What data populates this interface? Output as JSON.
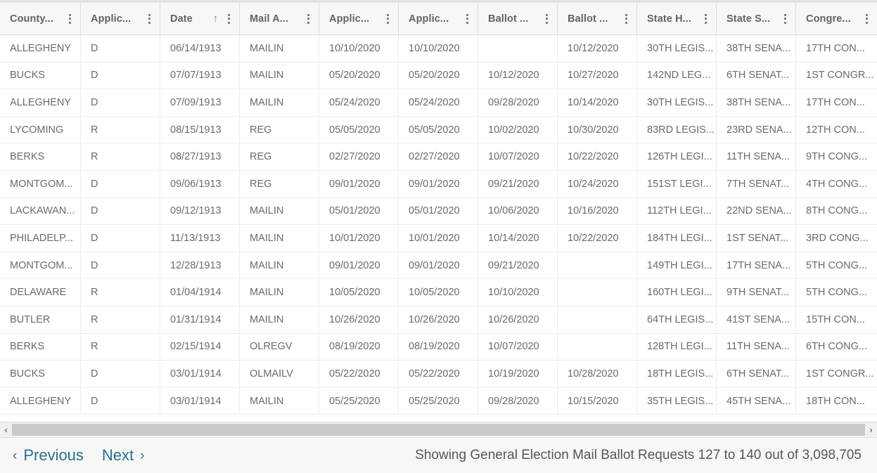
{
  "table": {
    "columns": [
      {
        "label": "County...",
        "sorted": false,
        "sort_icon": "",
        "menu_icon": "kebab-menu-icon"
      },
      {
        "label": "Applic...",
        "sorted": false,
        "sort_icon": "",
        "menu_icon": "kebab-menu-icon"
      },
      {
        "label": "Date",
        "sorted": true,
        "sort_icon": "↑",
        "menu_icon": "kebab-menu-icon"
      },
      {
        "label": "Mail A...",
        "sorted": false,
        "sort_icon": "",
        "menu_icon": "kebab-menu-icon"
      },
      {
        "label": "Applic...",
        "sorted": false,
        "sort_icon": "",
        "menu_icon": "kebab-menu-icon"
      },
      {
        "label": "Applic...",
        "sorted": false,
        "sort_icon": "",
        "menu_icon": "kebab-menu-icon"
      },
      {
        "label": "Ballot ...",
        "sorted": false,
        "sort_icon": "",
        "menu_icon": "kebab-menu-icon"
      },
      {
        "label": "Ballot ...",
        "sorted": false,
        "sort_icon": "",
        "menu_icon": "kebab-menu-icon"
      },
      {
        "label": "State H...",
        "sorted": false,
        "sort_icon": "",
        "menu_icon": "kebab-menu-icon"
      },
      {
        "label": "State S...",
        "sorted": false,
        "sort_icon": "",
        "menu_icon": "kebab-menu-icon"
      },
      {
        "label": "Congre...",
        "sorted": false,
        "sort_icon": "",
        "menu_icon": "kebab-menu-icon"
      }
    ],
    "rows": [
      [
        "ALLEGHENY",
        "D",
        "06/14/1913",
        "MAILIN",
        "10/10/2020",
        "10/10/2020",
        "",
        "10/12/2020",
        "30TH LEGIS...",
        "38TH SENA...",
        "17TH CON..."
      ],
      [
        "BUCKS",
        "D",
        "07/07/1913",
        "MAILIN",
        "05/20/2020",
        "05/20/2020",
        "10/12/2020",
        "10/27/2020",
        "142ND LEG...",
        "6TH SENAT...",
        "1ST CONGR..."
      ],
      [
        "ALLEGHENY",
        "D",
        "07/09/1913",
        "MAILIN",
        "05/24/2020",
        "05/24/2020",
        "09/28/2020",
        "10/14/2020",
        "30TH LEGIS...",
        "38TH SENA...",
        "17TH CON..."
      ],
      [
        "LYCOMING",
        "R",
        "08/15/1913",
        "REG",
        "05/05/2020",
        "05/05/2020",
        "10/02/2020",
        "10/30/2020",
        "83RD LEGIS...",
        "23RD SENA...",
        "12TH CON..."
      ],
      [
        "BERKS",
        "R",
        "08/27/1913",
        "REG",
        "02/27/2020",
        "02/27/2020",
        "10/07/2020",
        "10/22/2020",
        "126TH LEGI...",
        "11TH SENA...",
        "9TH CONG..."
      ],
      [
        "MONTGOM...",
        "D",
        "09/06/1913",
        "REG",
        "09/01/2020",
        "09/01/2020",
        "09/21/2020",
        "10/24/2020",
        "151ST LEGI...",
        "7TH SENAT...",
        "4TH CONG..."
      ],
      [
        "LACKAWAN...",
        "D",
        "09/12/1913",
        "MAILIN",
        "05/01/2020",
        "05/01/2020",
        "10/06/2020",
        "10/16/2020",
        "112TH LEGI...",
        "22ND SENA...",
        "8TH CONG..."
      ],
      [
        "PHILADELP...",
        "D",
        "11/13/1913",
        "MAILIN",
        "10/01/2020",
        "10/01/2020",
        "10/14/2020",
        "10/22/2020",
        "184TH LEGI...",
        "1ST SENAT...",
        "3RD CONG..."
      ],
      [
        "MONTGOM...",
        "D",
        "12/28/1913",
        "MAILIN",
        "09/01/2020",
        "09/01/2020",
        "09/21/2020",
        "",
        "149TH LEGI...",
        "17TH SENA...",
        "5TH CONG..."
      ],
      [
        "DELAWARE",
        "R",
        "01/04/1914",
        "MAILIN",
        "10/05/2020",
        "10/05/2020",
        "10/10/2020",
        "",
        "160TH LEGI...",
        "9TH SENAT...",
        "5TH CONG..."
      ],
      [
        "BUTLER",
        "R",
        "01/31/1914",
        "MAILIN",
        "10/26/2020",
        "10/26/2020",
        "10/26/2020",
        "",
        "64TH LEGIS...",
        "41ST SENA...",
        "15TH CON..."
      ],
      [
        "BERKS",
        "R",
        "02/15/1914",
        "OLREGV",
        "08/19/2020",
        "08/19/2020",
        "10/07/2020",
        "",
        "128TH LEGI...",
        "11TH SENA...",
        "6TH CONG..."
      ],
      [
        "BUCKS",
        "D",
        "03/01/1914",
        "OLMAILV",
        "05/22/2020",
        "05/22/2020",
        "10/19/2020",
        "10/28/2020",
        "18TH LEGIS...",
        "6TH SENAT...",
        "1ST CONGR..."
      ],
      [
        "ALLEGHENY",
        "D",
        "03/01/1914",
        "MAILIN",
        "05/25/2020",
        "05/25/2020",
        "09/28/2020",
        "10/15/2020",
        "35TH LEGIS...",
        "45TH SENA...",
        "18TH CON..."
      ]
    ]
  },
  "scrollbar": {
    "left_arrow": "‹",
    "right_arrow": "›"
  },
  "footer": {
    "previous_label": "Previous",
    "previous_chevron": "‹",
    "next_label": "Next",
    "next_chevron": "›",
    "showing_text": "Showing General Election Mail Ballot Requests 127 to 140 out of 3,098,705",
    "link_color": "#2b6d8f"
  }
}
